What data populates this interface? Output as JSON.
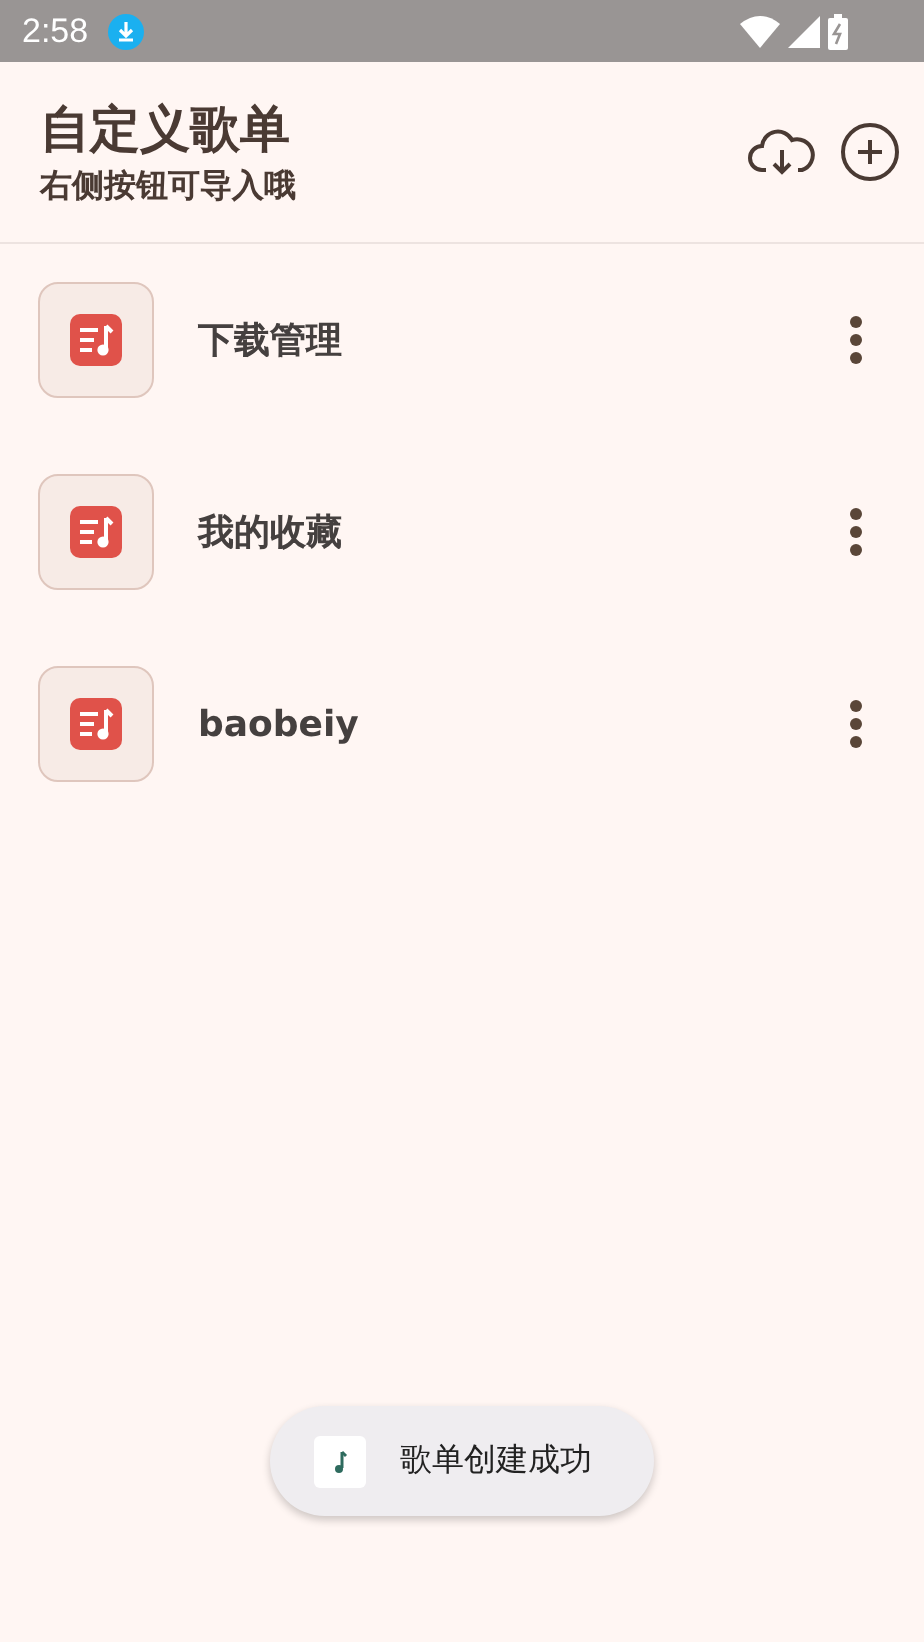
{
  "status_bar": {
    "time": "2:58"
  },
  "header": {
    "title": "自定义歌单",
    "subtitle": "右侧按钮可导入哦"
  },
  "playlists": [
    {
      "name": "下载管理"
    },
    {
      "name": "我的收藏"
    },
    {
      "name": "baobeiy"
    }
  ],
  "toast": {
    "text": "歌单创建成功"
  }
}
